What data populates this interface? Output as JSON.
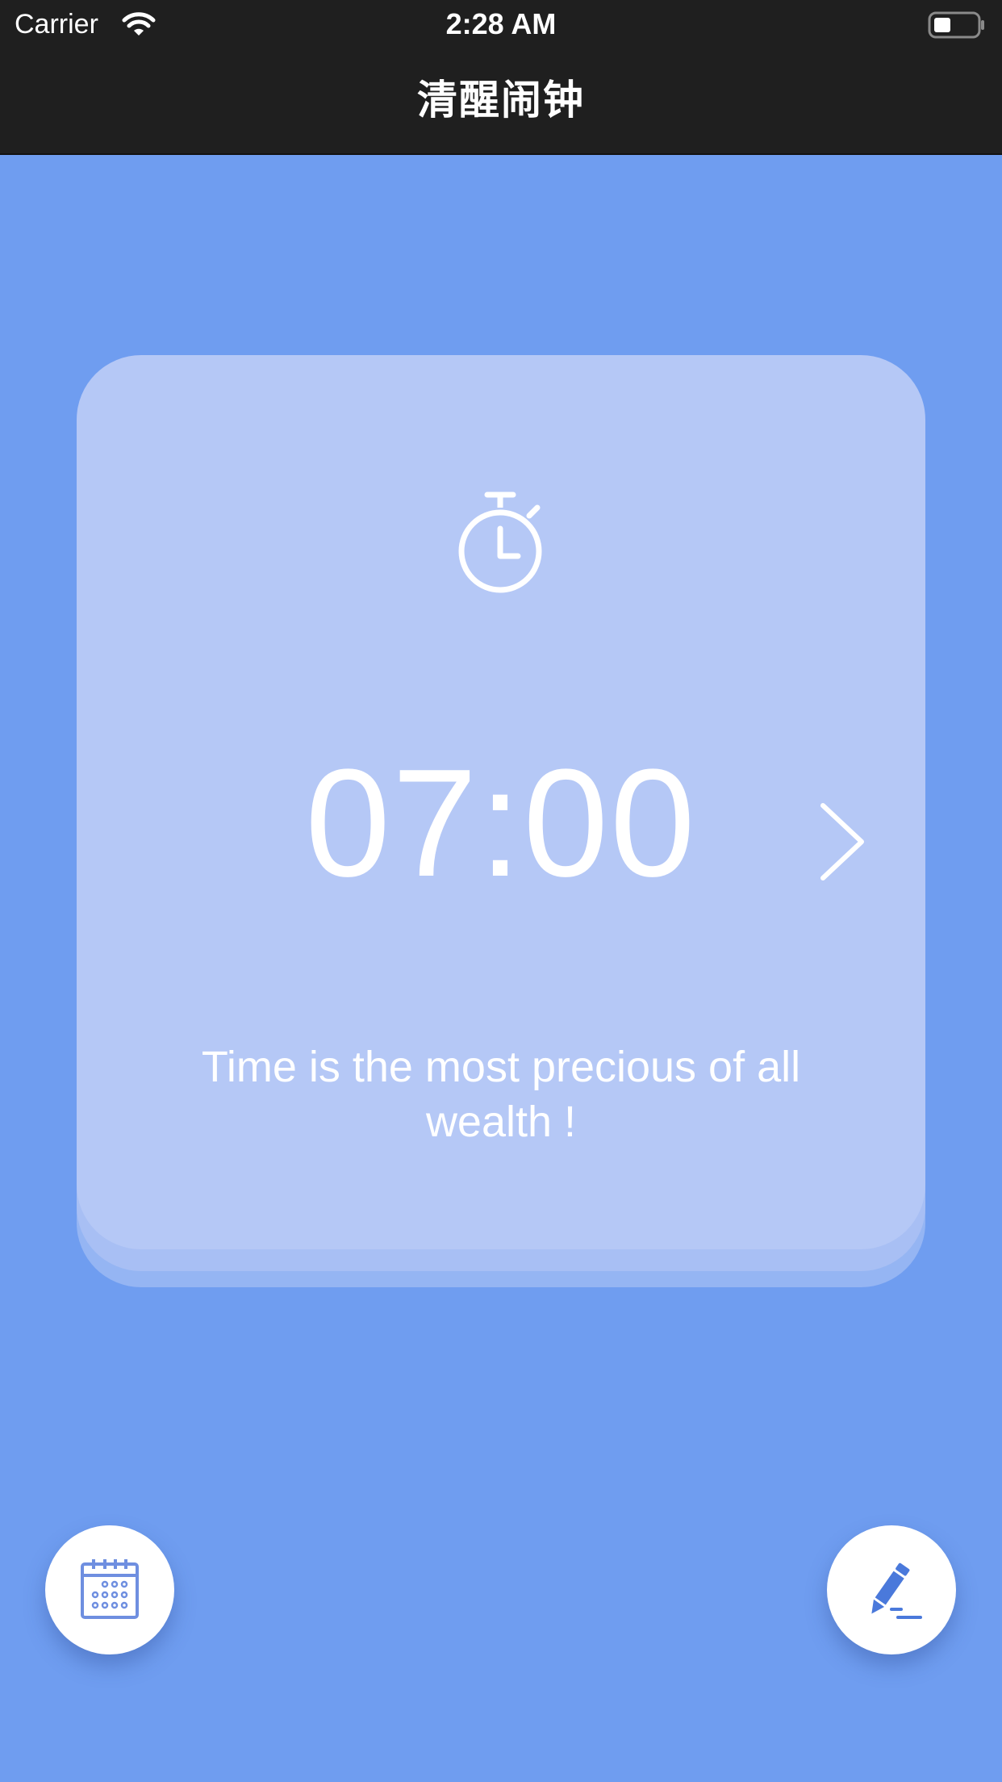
{
  "status_bar": {
    "carrier": "Carrier",
    "time": "2:28 AM"
  },
  "nav": {
    "title": "清醒闹钟"
  },
  "card": {
    "icon": "stopwatch-icon",
    "alarm_time": "07:00",
    "quote": "Time is the most precious of all wealth !"
  },
  "actions": {
    "left_icon": "calendar-icon",
    "right_icon": "edit-pencil-icon"
  },
  "colors": {
    "background": "#6f9df0",
    "card": "#b5c8f6",
    "bar": "#1f1f1f",
    "icon_accent": "#4a79db"
  }
}
